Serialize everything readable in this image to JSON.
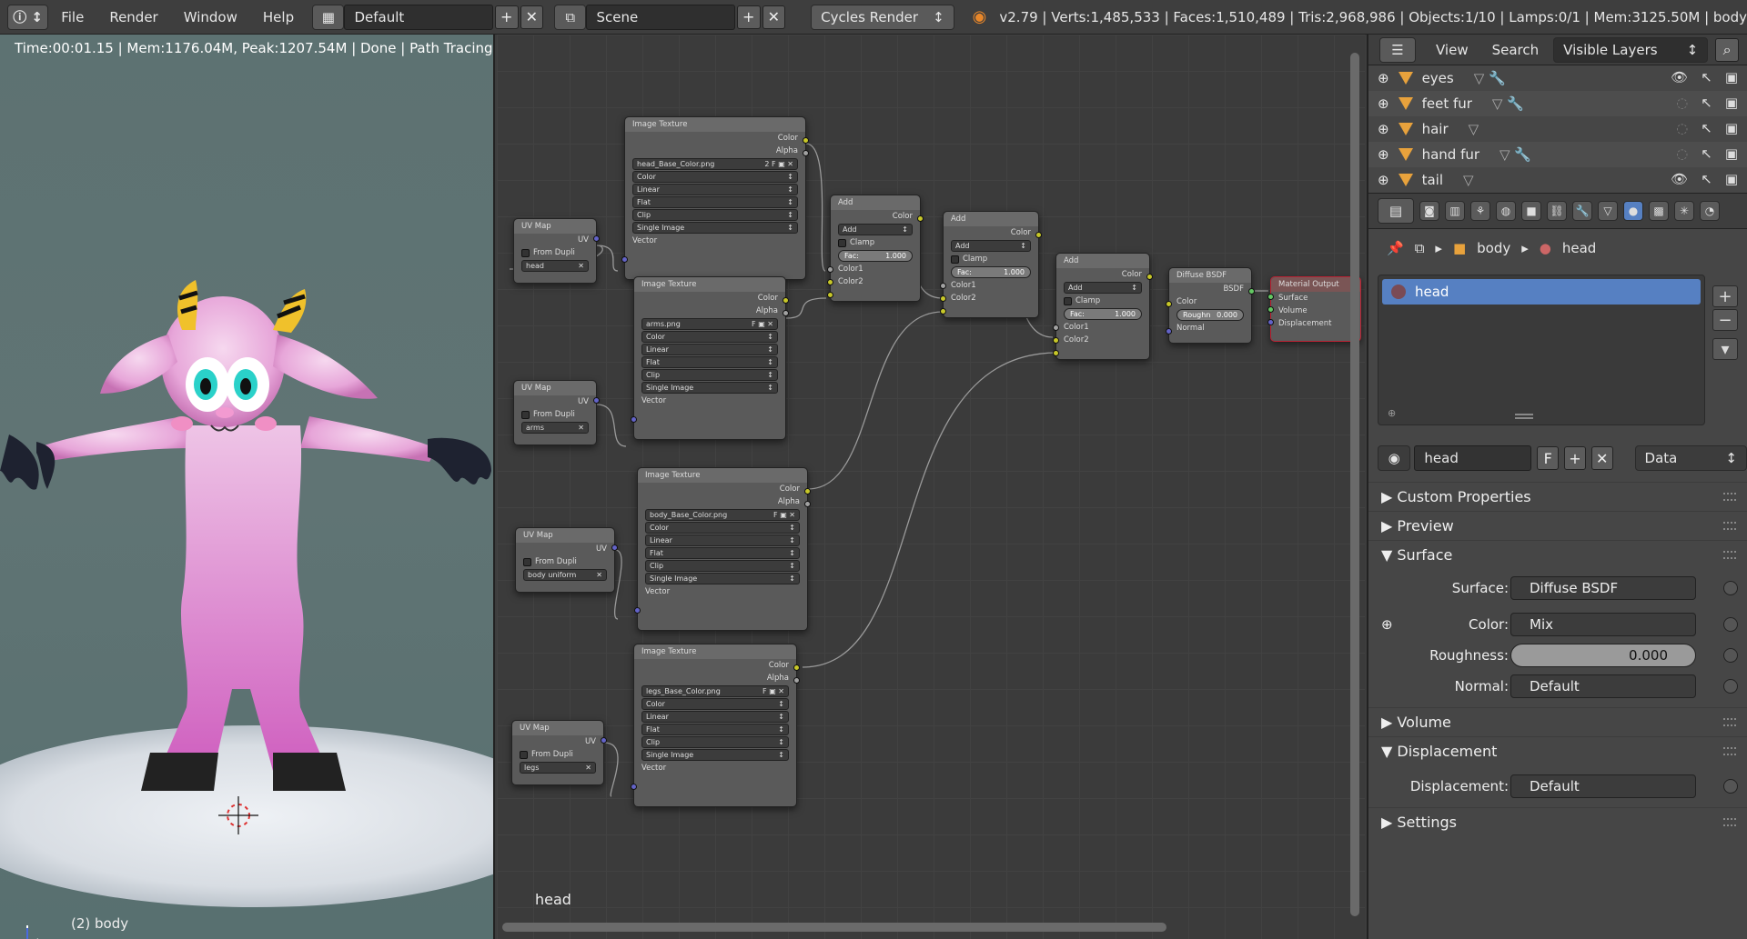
{
  "topbar": {
    "menus": [
      "File",
      "Render",
      "Window",
      "Help"
    ],
    "layout": "Default",
    "scene": "Scene",
    "engine": "Cycles Render",
    "stats": "v2.79 | Verts:1,485,533 | Faces:1,510,489 | Tris:2,968,986 | Objects:1/10 | Lamps:0/1 | Mem:3125.50M | body"
  },
  "viewport": {
    "render_status": "Time:00:01.15 | Mem:1176.04M, Peak:1207.54M | Done | Path Tracing Sa",
    "object_label": "(2) body"
  },
  "node_editor": {
    "label": "head",
    "nodes": {
      "tex_head": {
        "title": "Image Texture",
        "out1": "Color",
        "out2": "Alpha",
        "image": "head_Base_Color.png",
        "users": "2",
        "f": "F",
        "opts": [
          "Color",
          "Linear",
          "Flat",
          "Clip",
          "Single Image"
        ],
        "in": "Vector"
      },
      "tex_arms": {
        "title": "Image Texture",
        "out1": "Color",
        "out2": "Alpha",
        "image": "arms.png",
        "f": "F",
        "opts": [
          "Color",
          "Linear",
          "Flat",
          "Clip",
          "Single Image"
        ],
        "in": "Vector"
      },
      "tex_body": {
        "title": "Image Texture",
        "out1": "Color",
        "out2": "Alpha",
        "image": "body_Base_Color.png",
        "f": "F",
        "opts": [
          "Color",
          "Linear",
          "Flat",
          "Clip",
          "Single Image"
        ],
        "in": "Vector"
      },
      "tex_legs": {
        "title": "Image Texture",
        "out1": "Color",
        "out2": "Alpha",
        "image": "legs_Base_Color.png",
        "f": "F",
        "opts": [
          "Color",
          "Linear",
          "Flat",
          "Clip",
          "Single Image"
        ],
        "in": "Vector"
      },
      "uv1": {
        "title": "UV Map",
        "out": "UV",
        "chk": "From Dupli",
        "map": "head"
      },
      "uv2": {
        "title": "UV Map",
        "out": "UV",
        "chk": "From Dupli",
        "map": "arms"
      },
      "uv3": {
        "title": "UV Map",
        "out": "UV",
        "chk": "From Dupli",
        "map": "body uniform"
      },
      "uv4": {
        "title": "UV Map",
        "out": "UV",
        "chk": "From Dupli",
        "map": "legs"
      },
      "add1": {
        "title": "Add",
        "out": "Color",
        "mode": "Add",
        "clamp": "Clamp",
        "fac_label": "Fac:",
        "fac": "1.000",
        "in1": "Color1",
        "in2": "Color2"
      },
      "add2": {
        "title": "Add",
        "out": "Color",
        "mode": "Add",
        "clamp": "Clamp",
        "fac_label": "Fac:",
        "fac": "1.000",
        "in1": "Color1",
        "in2": "Color2"
      },
      "add3": {
        "title": "Add",
        "out": "Color",
        "mode": "Add",
        "clamp": "Clamp",
        "fac_label": "Fac:",
        "fac": "1.000",
        "in1": "Color1",
        "in2": "Color2"
      },
      "diffuse": {
        "title": "Diffuse BSDF",
        "out": "BSDF",
        "in_color": "Color",
        "rough_label": "Roughn",
        "rough": "0.000",
        "in_normal": "Normal"
      },
      "output": {
        "title": "Material Output",
        "in1": "Surface",
        "in2": "Volume",
        "in3": "Displacement"
      }
    }
  },
  "outliner": {
    "menu_view": "View",
    "menu_search": "Search",
    "filter": "Visible Layers",
    "items": [
      "eyes",
      "feet fur",
      "hair",
      "hand fur",
      "tail"
    ]
  },
  "properties": {
    "crumb_object": "body",
    "crumb_material": "head",
    "slot_name": "head",
    "material_name": "head",
    "material_f": "F",
    "link": "Data",
    "sections": {
      "custom": "Custom Properties",
      "preview": "Preview",
      "surface": "Surface",
      "volume": "Volume",
      "displacement": "Displacement",
      "settings": "Settings"
    },
    "surface_label": "Surface:",
    "surface_value": "Diffuse BSDF",
    "color_label": "Color:",
    "color_value": "Mix",
    "roughness_label": "Roughness:",
    "roughness_value": "0.000",
    "normal_label": "Normal:",
    "normal_value": "Default",
    "displacement_label": "Displacement:",
    "displacement_value": "Default"
  }
}
